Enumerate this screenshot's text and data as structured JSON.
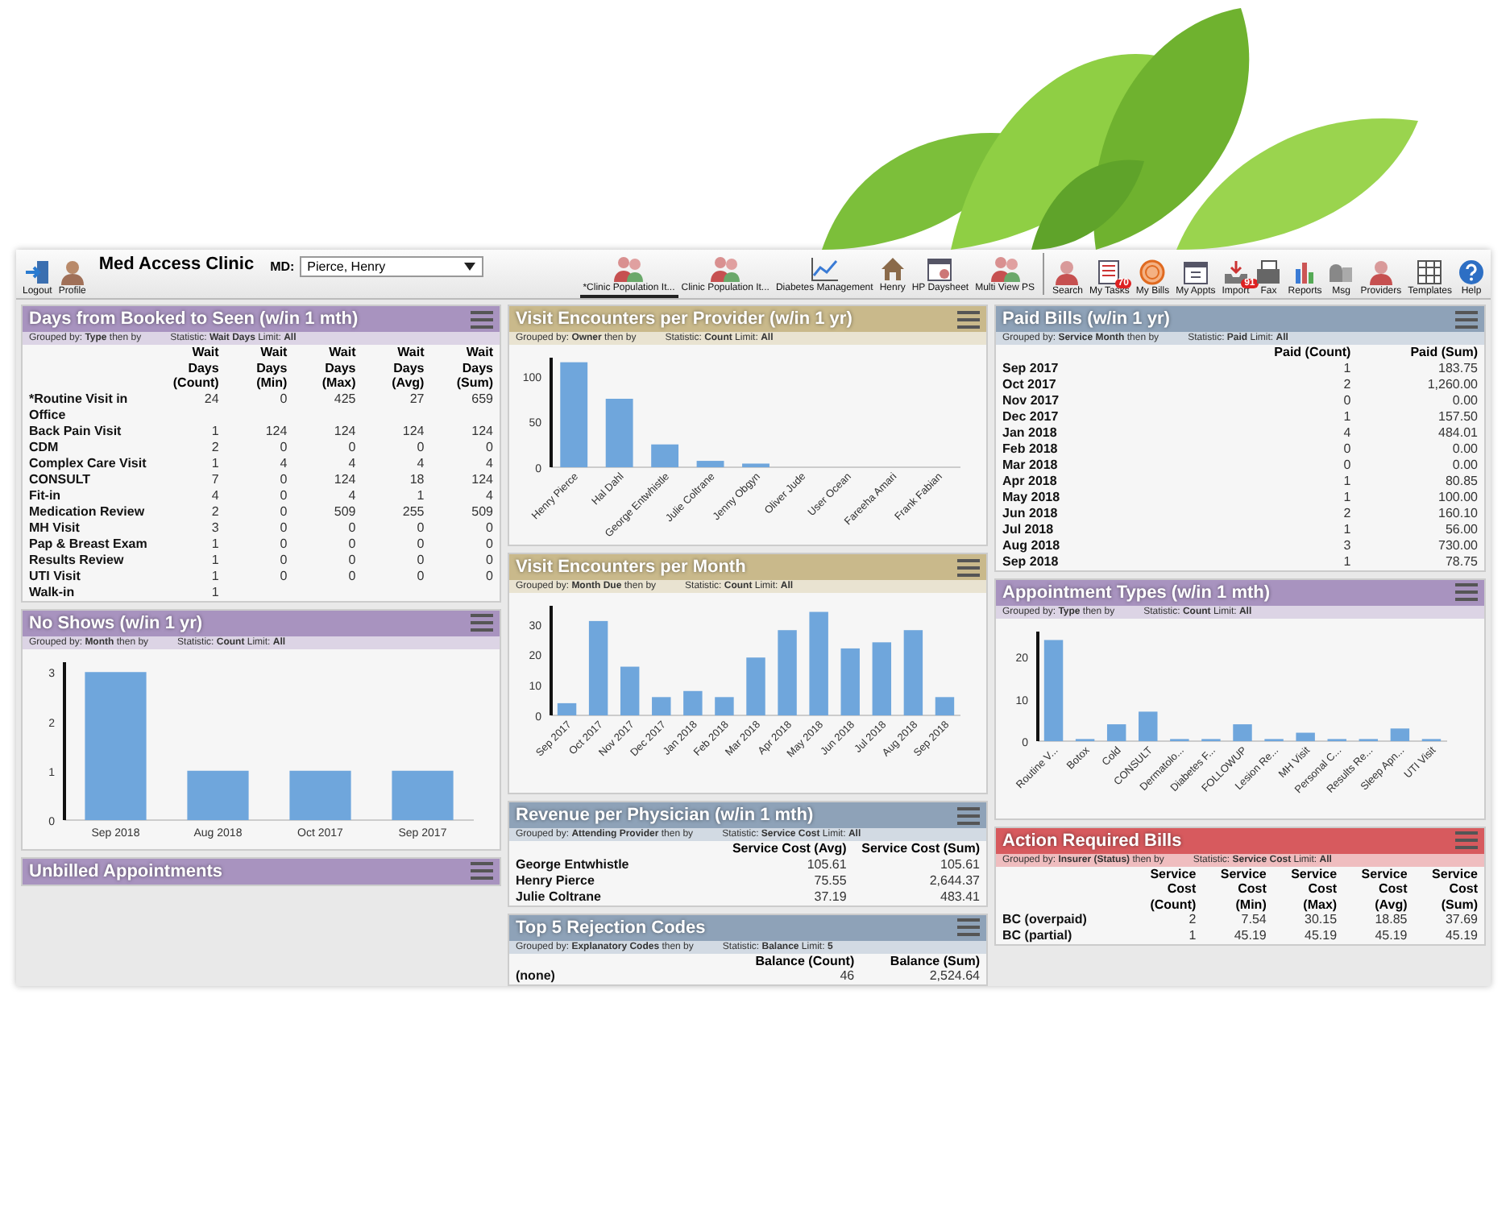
{
  "toolbar": {
    "left_buttons": [
      {
        "label": "Logout"
      },
      {
        "label": "Profile"
      }
    ],
    "clinic_name": "Med Access Clinic",
    "md_label": "MD:",
    "md_select": {
      "value": "Pierce, Henry"
    },
    "tabs": [
      {
        "label": "*Clinic Population It...",
        "selected": true
      },
      {
        "label": "Clinic Population It...",
        "selected": false
      },
      {
        "label": "Diabetes Management",
        "selected": false
      },
      {
        "label": "Henry",
        "selected": false
      },
      {
        "label": "HP Daysheet",
        "selected": false
      },
      {
        "label": "Multi View PS",
        "selected": false
      }
    ],
    "tools": [
      {
        "label": "Search"
      },
      {
        "label": "My Tasks",
        "badge": "70"
      },
      {
        "label": "My Bills"
      },
      {
        "label": "My Appts"
      },
      {
        "label": "Import",
        "badge": "91"
      },
      {
        "label": "Fax"
      },
      {
        "label": "Reports"
      },
      {
        "label": "Msg"
      },
      {
        "label": "Providers"
      },
      {
        "label": "Templates"
      },
      {
        "label": "Help"
      }
    ]
  },
  "columns": [
    {
      "panels": [
        {
          "kind": "table",
          "title": "Days from Booked to Seen (w/in 1 mth)",
          "color": "#a893bf",
          "filter_left": "Grouped by: **Type** then by",
          "filter_right": "Statistic: **Wait Days**  Limit: **All**",
          "table": {
            "columns": [
              "Wait Days (Count)",
              "Wait Days (Min)",
              "Wait Days (Max)",
              "Wait Days (Avg)",
              "Wait Days (Sum)"
            ],
            "rows": [
              {
                "label": "*Routine Visit in Office",
                "cells": [
                  "24",
                  "0",
                  "425",
                  "27",
                  "659"
                ]
              },
              {
                "label": "Back Pain Visit",
                "cells": [
                  "1",
                  "124",
                  "124",
                  "124",
                  "124"
                ]
              },
              {
                "label": "CDM",
                "cells": [
                  "2",
                  "0",
                  "0",
                  "0",
                  "0"
                ]
              },
              {
                "label": "Complex Care Visit",
                "cells": [
                  "1",
                  "4",
                  "4",
                  "4",
                  "4"
                ]
              },
              {
                "label": "CONSULT",
                "cells": [
                  "7",
                  "0",
                  "124",
                  "18",
                  "124"
                ]
              },
              {
                "label": "Fit-in",
                "cells": [
                  "4",
                  "0",
                  "4",
                  "1",
                  "4"
                ]
              },
              {
                "label": "Medication Review",
                "cells": [
                  "2",
                  "0",
                  "509",
                  "255",
                  "509"
                ]
              },
              {
                "label": "MH Visit",
                "cells": [
                  "3",
                  "0",
                  "0",
                  "0",
                  "0"
                ]
              },
              {
                "label": "Pap & Breast Exam",
                "cells": [
                  "1",
                  "0",
                  "0",
                  "0",
                  "0"
                ]
              },
              {
                "label": "Results Review",
                "cells": [
                  "1",
                  "0",
                  "0",
                  "0",
                  "0"
                ]
              },
              {
                "label": "UTI Visit",
                "cells": [
                  "1",
                  "0",
                  "0",
                  "0",
                  "0"
                ]
              },
              {
                "label": "Walk-in",
                "cells": [
                  "1"
                ]
              }
            ]
          }
        },
        {
          "kind": "chart",
          "title": "No Shows (w/in 1 yr)",
          "color": "#a893bf",
          "filter_left": "Grouped by: **Month** then by",
          "filter_right": "Statistic: **Count**  Limit: **All**",
          "chart_data": {
            "type": "bar",
            "categories": [
              "Sep 2018",
              "Aug 2018",
              "Oct 2017",
              "Sep 2017"
            ],
            "values": [
              3,
              1,
              1,
              1
            ],
            "ylim": [
              0,
              3.2
            ],
            "yticks": [
              0,
              1,
              2,
              3
            ]
          }
        },
        {
          "kind": "stub",
          "title": "Unbilled Appointments",
          "color": "#a893bf"
        }
      ]
    },
    {
      "panels": [
        {
          "kind": "chart",
          "title": "Visit Encounters per Provider (w/in 1 yr)",
          "color": "#c9b98b",
          "filter_left": "Grouped by: **Owner** then by",
          "filter_right": "Statistic: **Count**  Limit: **All**",
          "chart_data": {
            "type": "bar",
            "categories": [
              "Henry Pierce",
              "Hal Dahl",
              "George Entwhistle",
              "Julie Coltrane",
              "Jenny Obgyn",
              "Oliver Jude",
              "User Ocean",
              "Fareeha Amari",
              "Frank Fabian"
            ],
            "values": [
              115,
              75,
              25,
              7,
              4,
              0,
              0,
              0,
              0
            ],
            "ylim": [
              0,
              120
            ],
            "yticks": [
              0,
              50,
              100
            ]
          }
        },
        {
          "kind": "chart",
          "title": "Visit Encounters per Month",
          "color": "#c9b98b",
          "filter_left": "Grouped by: **Month Due** then by",
          "filter_right": "Statistic: **Count**  Limit: **All**",
          "chart_data": {
            "type": "bar",
            "categories": [
              "Sep 2017",
              "Oct 2017",
              "Nov 2017",
              "Dec 2017",
              "Jan 2018",
              "Feb 2018",
              "Mar 2018",
              "Apr 2018",
              "May 2018",
              "Jun 2018",
              "Jul 2018",
              "Aug 2018",
              "Sep 2018"
            ],
            "values": [
              4,
              31,
              16,
              6,
              8,
              6,
              19,
              28,
              34,
              22,
              24,
              28,
              6
            ],
            "ylim": [
              0,
              36
            ],
            "yticks": [
              0,
              10,
              20,
              30
            ]
          }
        },
        {
          "kind": "table",
          "title": "Revenue per Physician (w/in 1 mth)",
          "color": "#8ea2b8",
          "filter_left": "Grouped by: **Attending Provider** then by",
          "filter_right": "Statistic: **Service Cost**  Limit: **All**",
          "table": {
            "columns": [
              "Service Cost (Avg)",
              "Service Cost (Sum)"
            ],
            "rows": [
              {
                "label": "George Entwhistle",
                "cells": [
                  "105.61",
                  "105.61"
                ]
              },
              {
                "label": "Henry Pierce",
                "cells": [
                  "75.55",
                  "2,644.37"
                ]
              },
              {
                "label": "Julie Coltrane",
                "cells": [
                  "37.19",
                  "483.41"
                ]
              }
            ]
          }
        },
        {
          "kind": "table",
          "title": "Top 5 Rejection Codes",
          "color": "#8ea2b8",
          "filter_left": "Grouped by: **Explanatory Codes** then by",
          "filter_right": "Statistic: **Balance**  Limit: **5**",
          "table": {
            "columns": [
              "Balance (Count)",
              "Balance (Sum)"
            ],
            "rows": [
              {
                "label": "(none)",
                "cells": [
                  "46",
                  "2,524.64"
                ]
              }
            ]
          }
        }
      ]
    },
    {
      "panels": [
        {
          "kind": "table",
          "title": "Paid Bills (w/in 1 yr)",
          "color": "#8ea2b8",
          "filter_left": "Grouped by: **Service Month** then by",
          "filter_right": "Statistic: **Paid**  Limit: **All**",
          "table": {
            "columns": [
              "Paid (Count)",
              "Paid (Sum)"
            ],
            "rows": [
              {
                "label": "Sep 2017",
                "cells": [
                  "1",
                  "183.75"
                ]
              },
              {
                "label": "Oct 2017",
                "cells": [
                  "2",
                  "1,260.00"
                ]
              },
              {
                "label": "Nov 2017",
                "cells": [
                  "0",
                  "0.00"
                ]
              },
              {
                "label": "Dec 2017",
                "cells": [
                  "1",
                  "157.50"
                ]
              },
              {
                "label": "Jan 2018",
                "cells": [
                  "4",
                  "484.01"
                ]
              },
              {
                "label": "Feb 2018",
                "cells": [
                  "0",
                  "0.00"
                ]
              },
              {
                "label": "Mar 2018",
                "cells": [
                  "0",
                  "0.00"
                ]
              },
              {
                "label": "Apr 2018",
                "cells": [
                  "1",
                  "80.85"
                ]
              },
              {
                "label": "May 2018",
                "cells": [
                  "1",
                  "100.00"
                ]
              },
              {
                "label": "Jun 2018",
                "cells": [
                  "2",
                  "160.10"
                ]
              },
              {
                "label": "Jul 2018",
                "cells": [
                  "1",
                  "56.00"
                ]
              },
              {
                "label": "Aug 2018",
                "cells": [
                  "3",
                  "730.00"
                ]
              },
              {
                "label": "Sep 2018",
                "cells": [
                  "1",
                  "78.75"
                ]
              }
            ]
          }
        },
        {
          "kind": "chart",
          "title": "Appointment Types (w/in 1 mth)",
          "color": "#a893bf",
          "filter_left": "Grouped by: **Type** then by",
          "filter_right": "Statistic: **Count**  Limit: **All**",
          "chart_data": {
            "type": "bar",
            "categories": [
              "Routine V...",
              "Botox",
              "Cold",
              "CONSULT",
              "Dermatolo...",
              "Diabetes F...",
              "FOLLOWUP",
              "Lesion Re...",
              "MH Visit",
              "Personal C...",
              "Results Re...",
              "Sleep Apn...",
              "UTI Visit"
            ],
            "values": [
              24,
              0.5,
              4,
              7,
              0.5,
              0.5,
              4,
              0.5,
              2,
              0.5,
              0.5,
              3,
              0.5
            ],
            "ylim": [
              0,
              26
            ],
            "yticks": [
              0,
              10,
              20
            ]
          }
        },
        {
          "kind": "table",
          "title": "Action Required Bills",
          "color": "#d75a5e",
          "filter_left": "Grouped by: **Insurer (Status)** then by",
          "filter_right": "Statistic: **Service Cost**  Limit: **All**",
          "table": {
            "columns": [
              "Service Cost (Count)",
              "Service Cost (Min)",
              "Service Cost (Max)",
              "Service Cost (Avg)",
              "Service Cost (Sum)"
            ],
            "rows": [
              {
                "label": "BC (overpaid)",
                "cells": [
                  "2",
                  "7.54",
                  "30.15",
                  "18.85",
                  "37.69"
                ]
              },
              {
                "label": "BC (partial)",
                "cells": [
                  "1",
                  "45.19",
                  "45.19",
                  "45.19",
                  "45.19"
                ]
              }
            ]
          }
        }
      ]
    }
  ]
}
